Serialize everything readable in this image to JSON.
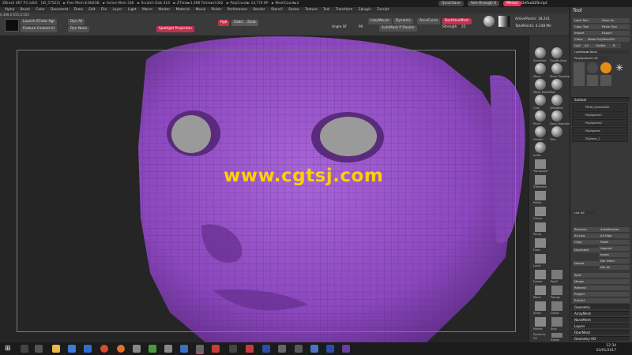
{
  "titlebar": {
    "items": [
      "ZBrush 4R7 P3 (x64)",
      "[ID_57523]",
      "► Free Mem 8.682GB",
      "► Active Mem 546",
      "► Scratch Disk 414",
      "► ZTime►1.398 Timer►0.002",
      "► PolyCount► 14,774 KP",
      "► MeshCount►2"
    ],
    "quicksave": "QuickSave",
    "seethrough": "See-through   0",
    "menus": "Menus",
    "defaultscript": "DefaultZScript",
    "coords": "0.308,0.655,0.554"
  },
  "menubar": [
    "Alpha",
    "Brush",
    "Color",
    "Document",
    "Draw",
    "Edit",
    "File",
    "Layer",
    "Light",
    "Macro",
    "Marker",
    "Material",
    "Movie",
    "Picker",
    "Preferences",
    "Render",
    "Stencil",
    "Stroke",
    "Texture",
    "Tool",
    "Transform",
    "Zplugin",
    "Zscript"
  ],
  "topshelf": {
    "launch_zcolor": "Launch ZColor Hgr",
    "dyn_all": "Dyn All",
    "feature_custom": "Feature Custom UI",
    "dyn_none": "Dyn None",
    "spotlight": "Spotlight Projection",
    "rgb": "Rgb",
    "zadd": "Zadd",
    "zsub": "Zsub",
    "lazymouse": "LazyMouse",
    "dynamic": "Dynamic",
    "accucurve": "AccuCurve",
    "backface": "BackfaceMask",
    "angle_of": "Angle Of",
    "ang_value": "90",
    "automask": "AutoMask P Double",
    "strength_label": "Strength",
    "strength_value": "25",
    "active_points": "ActivePoints: 18,241",
    "total_points": "TotalPoints: 4.248 Mil"
  },
  "viewport": {
    "watermark": "www.cgtsj.com"
  },
  "rightshelf": {
    "labels": [
      "Standard",
      "ClayBuildup",
      "Move",
      "Move Topological",
      "Move Elastic",
      "Flat",
      "Clay",
      "ZModeler",
      "Pinch",
      "Dam_Standard",
      "hPolish",
      "Trim",
      "Inflat",
      "Transpose",
      "ZRemesh",
      "Polish",
      "Gizmo",
      "Persp",
      "Floor",
      "Local",
      "Frame",
      "Move",
      "Scale",
      "Rotate",
      "PolyF",
      "Transp",
      "Ghost",
      "Solo",
      "Xpose",
      "Dynamic",
      "Fill",
      "AR High",
      "AR Low"
    ]
  },
  "toolpanel": {
    "title": "Tool",
    "buttons": {
      "load_tool": "Load Tool",
      "save_as": "Save As",
      "copy_tool": "Copy Tool",
      "paste_tool": "Paste Tool",
      "import": "Import",
      "export": "Export",
      "clone": "Clone",
      "make_polymesh": "Make PolyMesh3D",
      "goz": "GoZ",
      "all": "All",
      "visible": "Visible",
      "r": "R",
      "lightbox_tools": "Lightbox►Tools",
      "polysphere_count": "PolySphere2  49"
    },
    "subtool": {
      "header": "Subtool",
      "items": [
        "PM3D_Sphere3D2",
        "PolySphere1",
        "PolySphere2",
        "PolySphere",
        "ZSphere_1"
      ]
    },
    "list_all": "List All",
    "actions": {
      "rename": "Rename",
      "autoreorder": "AutoReorder",
      "all_low": "All Low",
      "all_high": "All High",
      "copy": "Copy",
      "paste": "Paste",
      "duplicate": "Duplicate",
      "append": "Append",
      "insert": "Insert",
      "delete": "Delete",
      "del_other": "Del Other",
      "del_all": "Del All",
      "split": "Split",
      "merge": "Merge",
      "remesh": "Remesh",
      "project": "Project",
      "extract": "Extract"
    },
    "sections": [
      "Geometry",
      "ArrayMesh",
      "NanoMesh",
      "Layers",
      "FiberMesh",
      "Geometry HD"
    ]
  },
  "taskbar": {
    "time": "12:34",
    "date": "03/01/2017"
  },
  "colors": {
    "accent": "#e8335e",
    "watermark": "#ffd000",
    "face": "#8a48b8",
    "spotlight": "#c0304f"
  }
}
